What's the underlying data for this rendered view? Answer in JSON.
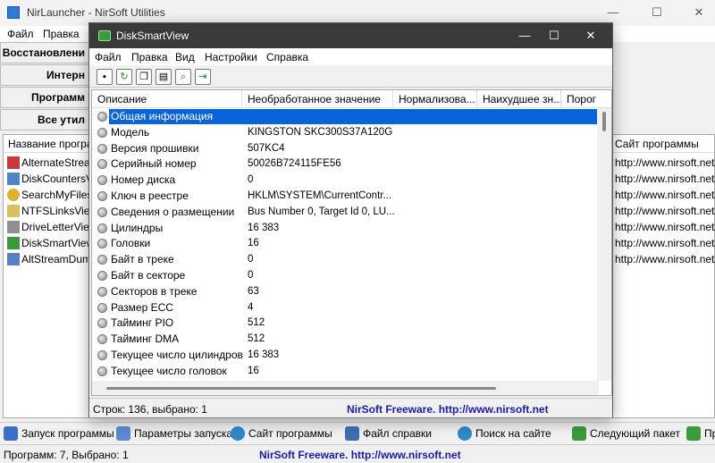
{
  "background_window": {
    "title": "NirLauncher   -   NirSoft Utilities",
    "window_buttons": {
      "minimize": "—",
      "maximize": "☐",
      "close": "✕"
    },
    "menu": [
      "Файл",
      "Правка"
    ],
    "tabs": [
      "Восстановлени",
      "Интерн",
      "Программ",
      "Все утил"
    ],
    "list_headers": {
      "name": "Название програ",
      "website": "Сайт программы"
    },
    "rows": [
      {
        "name": "AlternateStream",
        "url": "http://www.nirsoft.net/u"
      },
      {
        "name": "DiskCountersVi",
        "url": "http://www.nirsoft.net/u"
      },
      {
        "name": "SearchMyFiles",
        "url": "http://www.nirsoft.net/u"
      },
      {
        "name": "NTFSLinksView",
        "url": "http://www.nirsoft.net/u"
      },
      {
        "name": "DriveLetterView",
        "url": "http://www.nirsoft.net/u"
      },
      {
        "name": "DiskSmartView",
        "url": "http://www.nirsoft.net/u"
      },
      {
        "name": "AltStreamDump",
        "url": "http://www.nirsoft.net/u"
      }
    ],
    "toolbar": {
      "run": "Запуск программы",
      "params": "Параметры запуска",
      "website": "Сайт программы",
      "help": "Файл справки",
      "search": "Поиск на сайте",
      "next_package": "Следующий пакет",
      "more": "Пр"
    },
    "status": {
      "left": "Программ: 7, Выбрано: 1",
      "link": "NirSoft Freeware.  http://www.nirsoft.net"
    },
    "colors": {
      "link": "#1a1aa6"
    }
  },
  "foreground_window": {
    "title": "DiskSmartView",
    "window_buttons": {
      "minimize": "—",
      "maximize": "☐",
      "close": "✕"
    },
    "menu": [
      "Файл",
      "Правка",
      "Вид",
      "Настройки",
      "Справка"
    ],
    "toolbar_icons": [
      "save-icon",
      "refresh-icon",
      "copy-icon",
      "properties-icon",
      "find-icon",
      "exit-icon"
    ],
    "columns": [
      "Описание",
      "Необработанное значение",
      "Нормализова...",
      "Наихудшее зн...",
      "Порог"
    ],
    "rows": [
      {
        "desc": "Общая информация",
        "raw": "",
        "selected": true
      },
      {
        "desc": "Модель",
        "raw": "KINGSTON SKC300S37A120G"
      },
      {
        "desc": "Версия прошивки",
        "raw": "507KC4"
      },
      {
        "desc": "Серийный номер",
        "raw": "50026B724115FE56"
      },
      {
        "desc": "Номер диска",
        "raw": "0"
      },
      {
        "desc": "Ключ в реестре",
        "raw": "HKLM\\SYSTEM\\CurrentContr..."
      },
      {
        "desc": "Сведения о размещении",
        "raw": "Bus Number 0, Target Id 0, LU..."
      },
      {
        "desc": "Цилиндры",
        "raw": "16 383"
      },
      {
        "desc": "Головки",
        "raw": "16"
      },
      {
        "desc": "Байт в треке",
        "raw": "0"
      },
      {
        "desc": "Байт в секторе",
        "raw": "0"
      },
      {
        "desc": "Секторов в треке",
        "raw": "63"
      },
      {
        "desc": "Размер ECC",
        "raw": "4"
      },
      {
        "desc": "Тайминг PIO",
        "raw": "512"
      },
      {
        "desc": "Тайминг DMA",
        "raw": "512"
      },
      {
        "desc": "Текущее число цилиндров",
        "raw": "16 383"
      },
      {
        "desc": "Текущее число головок",
        "raw": "16"
      }
    ],
    "status": {
      "left": "Строк: 136, выбрано: 1",
      "link": "NirSoft Freeware.  http://www.nirsoft.net"
    },
    "colors": {
      "title_bar": "#3a3a3a",
      "selection": "#0a64d7",
      "link": "#1a1aa6"
    }
  }
}
